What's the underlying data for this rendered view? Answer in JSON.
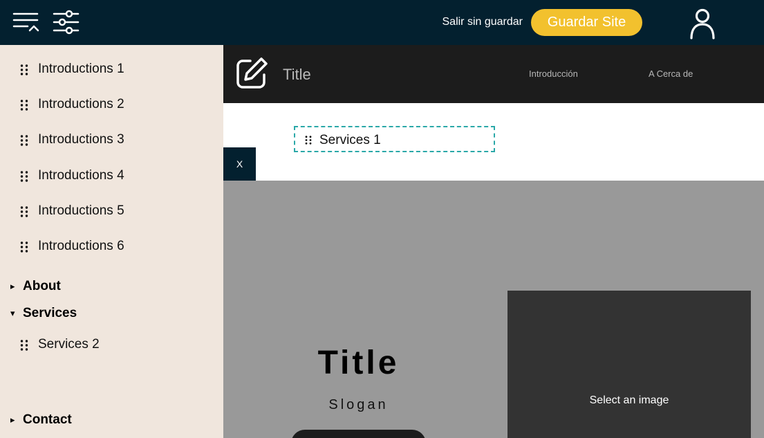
{
  "topbar": {
    "menu_icon": "menu-collapse-icon",
    "filter_icon": "sliders-icon",
    "exit_label": "Salir sin guardar",
    "save_label": "Guardar Site",
    "user_icon": "user-icon",
    "background": "#03202f",
    "save_color": "#f2c12e"
  },
  "sidebar": {
    "background": "#f0e6dd",
    "items": [
      {
        "label": "Introductions 1"
      },
      {
        "label": "Introductions 2"
      },
      {
        "label": "Introductions 3"
      },
      {
        "label": "Introductions 4"
      },
      {
        "label": "Introductions 5"
      },
      {
        "label": "Introductions 6"
      }
    ],
    "sections": [
      {
        "label": "About",
        "caret": "▸",
        "expanded": false
      },
      {
        "label": "Services",
        "caret": "▾",
        "expanded": true,
        "items": [
          {
            "label": "Services 2"
          }
        ]
      },
      {
        "label": "Contact",
        "caret": "▸",
        "expanded": false
      }
    ]
  },
  "site_header": {
    "title": "Title",
    "nav": [
      "Introducción",
      "A Cerca de"
    ],
    "edit_icon": "edit-icon"
  },
  "drag": {
    "label": "Services 1",
    "close_label": "X",
    "border_color": "#2aa8a8"
  },
  "hero": {
    "title": "Title",
    "slogan": "Slogan",
    "image_label": "Select an image"
  }
}
